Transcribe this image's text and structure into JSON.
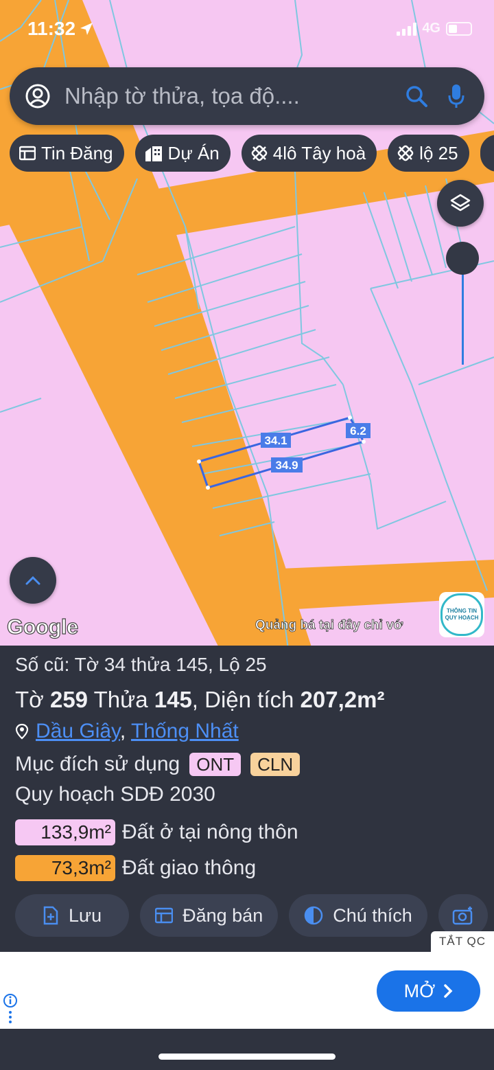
{
  "status": {
    "time": "11:32",
    "network": "4G"
  },
  "search": {
    "placeholder": "Nhập tờ thửa, tọa độ...."
  },
  "chips": [
    {
      "label": "Tin Đăng",
      "icon": "listing-icon"
    },
    {
      "label": "Dự Án",
      "icon": "buildings-icon"
    },
    {
      "label": "4lô Tây hoà",
      "icon": "parcel-icon"
    },
    {
      "label": "lộ 25",
      "icon": "parcel-icon"
    }
  ],
  "map": {
    "labels": [
      "34.1",
      "6.2",
      "34.9"
    ],
    "attribution": "Google",
    "promo": "Quảng bá tại đây chỉ vớ",
    "brand_line1": "THÔNG TIN",
    "brand_line2": "QUY HOẠCH",
    "colors": {
      "land": "#f6c7f2",
      "road": "#f7a436",
      "boundary": "#7fc7e0",
      "measure": "#3a66e0"
    }
  },
  "sheet": {
    "old": "Số cũ: Tờ 34 thửa 145, Lộ 25",
    "main": {
      "p1": "Tờ ",
      "sheet_no": "259",
      "p2": " Thửa ",
      "plot_no": "145",
      "p3": ", Diện tích ",
      "area": "207,2m²"
    },
    "location": {
      "district": "Dầu Giây",
      "sep": ",",
      "commune": "Thống Nhất"
    },
    "purpose_label": "Mục đích sử dụng",
    "tags": [
      {
        "text": "ONT",
        "color": "#f6c8f3"
      },
      {
        "text": "CLN",
        "color": "#f8d29c"
      }
    ],
    "plan_title": "Quy hoạch SDĐ 2030",
    "areas": [
      {
        "value": "133,9m²",
        "label": "Đất ở tại nông thôn",
        "color": "#f6c8f3"
      },
      {
        "value": "73,3m²",
        "label": "Đất giao thông",
        "color": "#f7a436"
      }
    ],
    "actions": [
      {
        "label": "Lưu",
        "icon": "save-icon"
      },
      {
        "label": "Đăng bán",
        "icon": "post-icon"
      },
      {
        "label": "Chú thích",
        "icon": "legend-icon"
      }
    ]
  },
  "ad": {
    "close": "TẮT QC",
    "open": "MỞ"
  }
}
